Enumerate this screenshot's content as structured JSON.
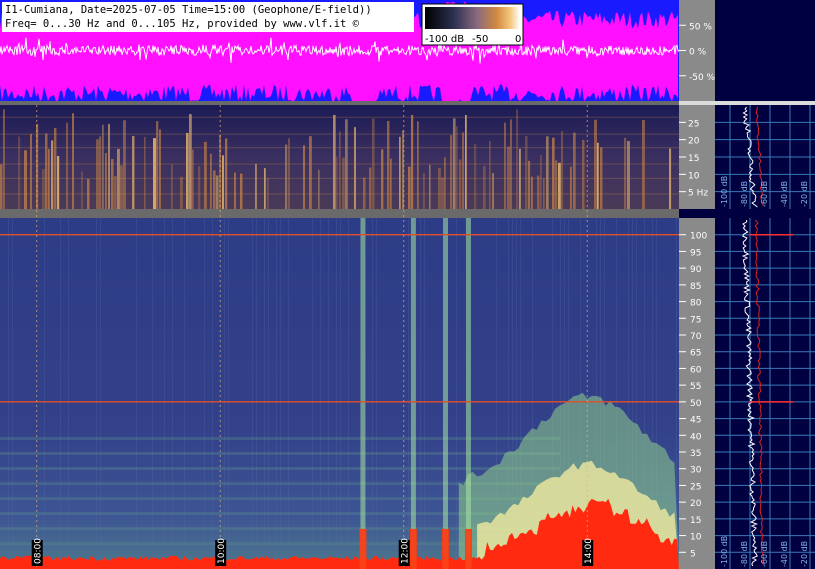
{
  "header": {
    "line1": "I1-Cumiana, Date=2025-07-05 Time=15:00 (Geophone/E-field))",
    "line2": "Freq= 0...30 Hz and 0...105 Hz, provided by www.vlf.it ©"
  },
  "colorbar": {
    "labels": [
      "-100 dB",
      "-50",
      "0"
    ]
  },
  "chart_data": [
    {
      "type": "area",
      "panel": "amplitude",
      "ylabel": "%",
      "y_ticks": [
        "50 %",
        "0 %",
        "-50 %"
      ],
      "y_tick_values": [
        50,
        0,
        -50
      ],
      "ylim": [
        -100,
        100
      ],
      "colors": {
        "background": "#1a1aff",
        "envelope": "#ff10ff",
        "trace": "#ffffff"
      }
    },
    {
      "type": "heatmap",
      "panel": "spectrogram-low",
      "y_ticks": [
        "5 Hz",
        "10",
        "15",
        "20",
        "25"
      ],
      "y_tick_values": [
        5,
        10,
        15,
        20,
        25
      ],
      "ylim": [
        0,
        30
      ]
    },
    {
      "type": "heatmap",
      "panel": "spectrogram-high",
      "y_ticks": [
        "5",
        "10",
        "15",
        "20",
        "25",
        "30",
        "35",
        "40",
        "45",
        "50",
        "55",
        "60",
        "65",
        "70",
        "75",
        "80",
        "85",
        "90",
        "95",
        "100"
      ],
      "y_tick_values": [
        5,
        10,
        15,
        20,
        25,
        30,
        35,
        40,
        45,
        50,
        55,
        60,
        65,
        70,
        75,
        80,
        85,
        90,
        95,
        100
      ],
      "ylim": [
        0,
        105
      ],
      "time_labels": [
        "08:00",
        "10:00",
        "12:00",
        "14:00"
      ],
      "time_values_h": [
        8,
        10,
        12,
        14
      ],
      "xlim_h": [
        7.6,
        15.0
      ],
      "lines_hz": [
        50,
        100
      ]
    },
    {
      "type": "line",
      "panel": "spectrum-low",
      "x_ticks": [
        "-100 dB",
        "-80 dB",
        "-60 dB",
        "-40 dB",
        "-20 dB"
      ]
    },
    {
      "type": "line",
      "panel": "spectrum-high",
      "x_ticks": [
        "-100 dB",
        "-80 dB",
        "-60 dB",
        "-40 dB",
        "-20 dB"
      ]
    }
  ]
}
